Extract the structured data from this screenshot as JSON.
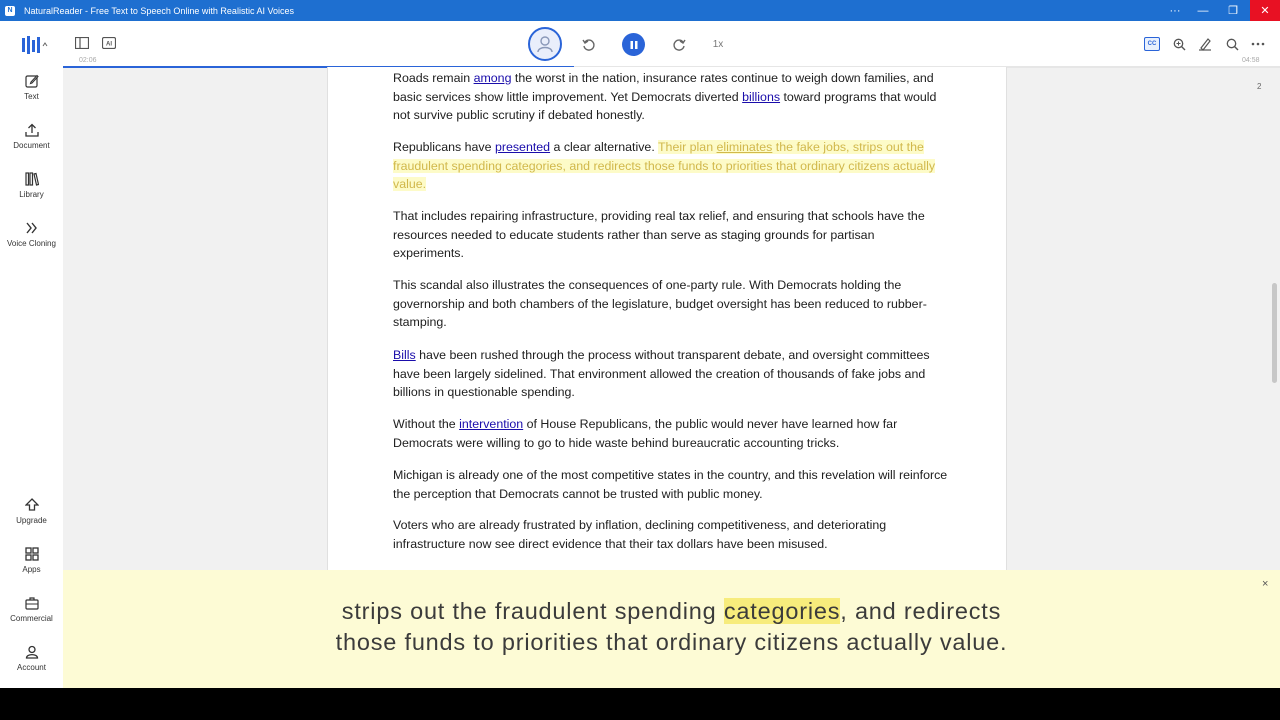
{
  "window": {
    "app_badge": "N",
    "title": "NaturalReader - Free Text to Speech Online with Realistic AI Voices",
    "controls": [
      "···",
      "—",
      "❐",
      "✕"
    ]
  },
  "toolbar": {
    "elapsed": "02:06",
    "duration": "04:58",
    "speed": "1x",
    "progress_fraction": 0.42,
    "icons": [
      "sidebar-icon",
      "ai-icon",
      "voice-avatar-icon",
      "rewind-icon",
      "pause-icon",
      "forward-icon",
      "cc-icon",
      "zoom-icon",
      "highlight-icon",
      "search-icon",
      "more-icon"
    ],
    "ai_label": "AI",
    "cc_label": "CC"
  },
  "sidebar": {
    "items": [
      {
        "label": "Text",
        "icon": "edit-icon"
      },
      {
        "label": "Document",
        "icon": "upload-icon"
      },
      {
        "label": "Library",
        "icon": "library-icon"
      },
      {
        "label": "Voice Cloning",
        "icon": "voice-clone-icon"
      },
      {
        "label": "Upgrade",
        "icon": "upgrade-icon"
      },
      {
        "label": "Apps",
        "icon": "apps-icon"
      },
      {
        "label": "Commercial",
        "icon": "briefcase-icon"
      },
      {
        "label": "Account",
        "icon": "account-icon"
      }
    ]
  },
  "document": {
    "page_number": "2",
    "p1": {
      "a": "Roads remain ",
      "link1": "among",
      "b": " the worst in the nation, insurance rates continue to weigh down families, and basic services show little improvement. Yet Democrats diverted ",
      "link2": "billions",
      "c": " toward programs that would not survive public scrutiny if debated honestly."
    },
    "p2": {
      "a": "Republicans have ",
      "link1": "presented",
      "b": " a clear alternative. ",
      "hl_a": "Their plan ",
      "hl_link": "eliminates",
      "hl_b": " the fake jobs, strips out the fraudulent spending categories, and redirects those funds to priorities that ordinary citizens actually value."
    },
    "p3": "That includes repairing infrastructure, providing real tax relief, and ensuring that schools have the resources needed to educate students rather than serve as staging grounds for partisan experiments.",
    "p4": "This scandal also illustrates the consequences of one-party rule. With Democrats holding the governorship and both chambers of the legislature, budget oversight has been reduced to rubber-stamping.",
    "p5": {
      "link1": "Bills",
      "a": " have been rushed through the process without transparent debate, and oversight committees have been largely sidelined. That environment allowed the creation of thousands of fake jobs and billions in questionable spending."
    },
    "p6": {
      "a": "Without the ",
      "link1": "intervention",
      "b": " of House Republicans, the public would never have learned how far Democrats were willing to go to hide waste behind bureaucratic accounting tricks."
    },
    "p7": "Michigan is already one of the most competitive states in the country, and this revelation will reinforce the perception that Democrats cannot be trusted with public money.",
    "p8": "Voters who are already frustrated by inflation, declining competitiveness, and deteriorating infrastructure now see direct evidence that their tax dollars have been misused."
  },
  "caption": {
    "line1_a": "strips out the fraudulent spending ",
    "line1_word": "categories",
    "line1_b": ", and redirects",
    "line2": "those funds to priorities that ordinary citizens actually value.",
    "close": "×"
  }
}
